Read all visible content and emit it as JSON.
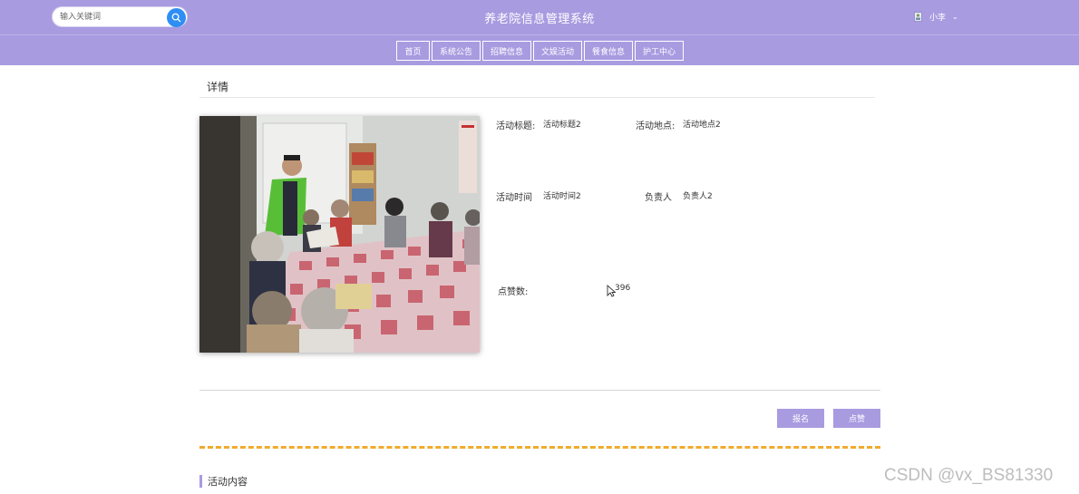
{
  "header": {
    "search_placeholder": "输入关键词",
    "site_title": "养老院信息管理系统",
    "user_name": "小李",
    "user_caret": "⌄"
  },
  "nav": [
    {
      "label": "首页"
    },
    {
      "label": "系统公告"
    },
    {
      "label": "招聘信息"
    },
    {
      "label": "文娱活动"
    },
    {
      "label": "餐食信息"
    },
    {
      "label": "护工中心"
    }
  ],
  "detail": {
    "section_title": "详情",
    "fields": {
      "title_label": "活动标题:",
      "title_value": "活动标题2",
      "place_label": "活动地点:",
      "place_value": "活动地点2",
      "time_label": "活动时间",
      "time_value": "活动时间2",
      "owner_label": "负责人",
      "owner_value": "负责人2",
      "likes_label": "点赞数:",
      "likes_value": "396"
    },
    "buttons": {
      "signup": "报名",
      "like": "点赞"
    },
    "content_heading": "活动内容"
  },
  "watermark": "CSDN @vx_BS81330",
  "colors": {
    "header_bg": "#a99be0",
    "accent": "#a99be0",
    "search_button": "#2f8ef4",
    "dashed_divider": "#f0aa2e"
  }
}
